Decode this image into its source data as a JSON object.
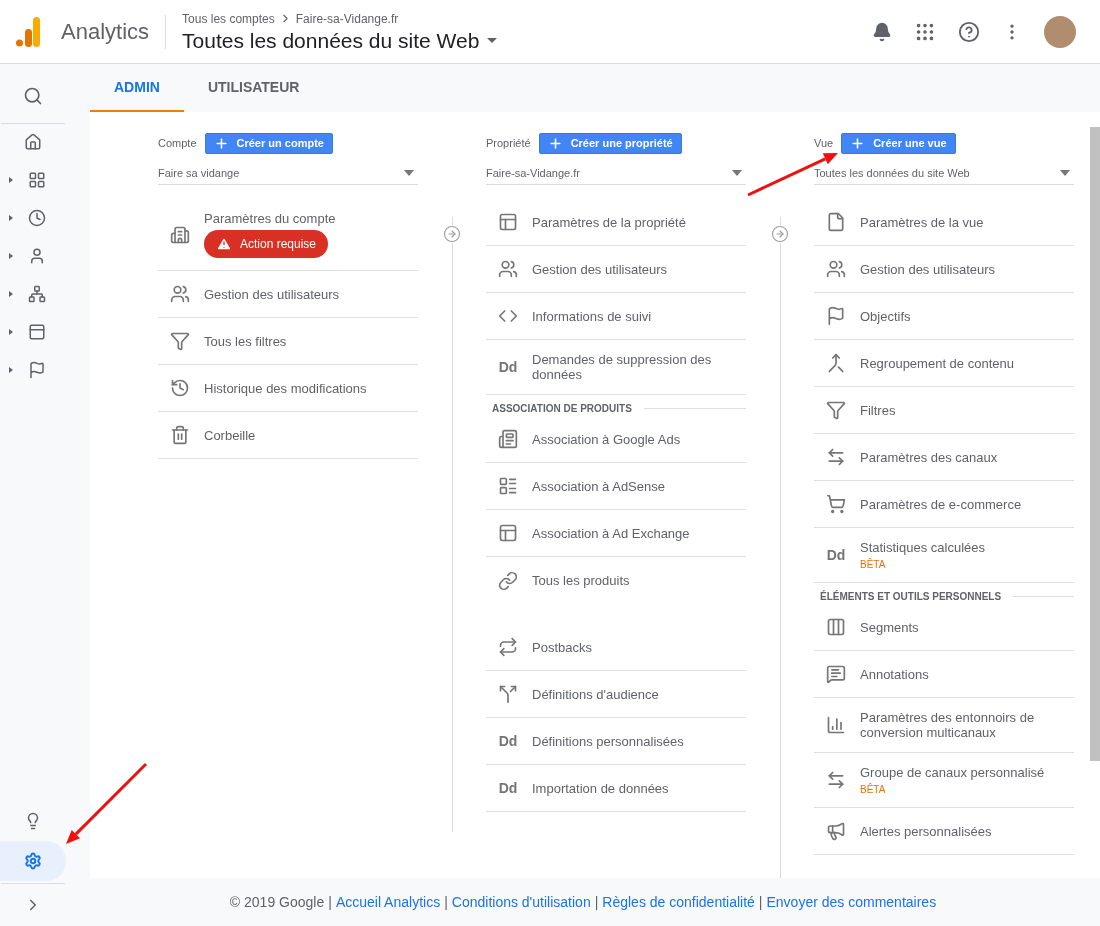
{
  "header": {
    "app_name": "Analytics",
    "breadcrumb": [
      "Tous les comptes",
      "Faire-sa-Vidange.fr"
    ],
    "view_title": "Toutes les données du site Web"
  },
  "sidebar": {
    "nav_items": [
      {
        "expanded": false
      },
      {
        "expanded": false
      },
      {
        "expanded": false
      },
      {
        "expanded": false
      },
      {
        "expanded": false
      },
      {
        "expanded": false
      }
    ],
    "bottom_items": [
      {
        "selected": false
      },
      {
        "selected": true
      }
    ]
  },
  "tabs": [
    {
      "label": "ADMIN",
      "selected": true
    },
    {
      "label": "UTILISATEUR",
      "selected": false
    }
  ],
  "columns": [
    {
      "label": "Compte",
      "create_button": "Créer un compte",
      "selector": "Faire sa vidange",
      "sections": [
        {
          "items": [
            {
              "label": "Paramètres du compte",
              "badge": "Action requise"
            },
            {
              "label": "Gestion des utilisateurs"
            },
            {
              "label": "Tous les filtres"
            },
            {
              "label": "Historique des modifications"
            },
            {
              "label": "Corbeille"
            }
          ]
        }
      ]
    },
    {
      "label": "Propriété",
      "create_button": "Créer une propriété",
      "selector": "Faire-sa-Vidange.fr",
      "sections": [
        {
          "items": [
            {
              "label": "Paramètres de la propriété"
            },
            {
              "label": "Gestion des utilisateurs"
            },
            {
              "label": "Informations de suivi"
            },
            {
              "label": "Demandes de suppression des données",
              "glyph": "Dd"
            }
          ]
        },
        {
          "heading": "ASSOCIATION DE PRODUITS",
          "items": [
            {
              "label": "Association à Google Ads"
            },
            {
              "label": "Association à AdSense"
            },
            {
              "label": "Association à Ad Exchange"
            },
            {
              "label": "Tous les produits"
            }
          ]
        },
        {
          "items": [
            {
              "label": "Postbacks"
            },
            {
              "label": "Définitions d'audience"
            },
            {
              "label": "Définitions personnalisées",
              "glyph": "Dd"
            },
            {
              "label": "Importation de données",
              "glyph": "Dd"
            }
          ]
        }
      ]
    },
    {
      "label": "Vue",
      "create_button": "Créer une vue",
      "selector": "Toutes les données du site Web",
      "sections": [
        {
          "items": [
            {
              "label": "Paramètres de la vue"
            },
            {
              "label": "Gestion des utilisateurs"
            },
            {
              "label": "Objectifs"
            },
            {
              "label": "Regroupement de contenu"
            },
            {
              "label": "Filtres"
            },
            {
              "label": "Paramètres des canaux"
            },
            {
              "label": "Paramètres de e-commerce"
            },
            {
              "label": "Statistiques calculées",
              "glyph": "Dd",
              "tag": "BÊTA"
            }
          ]
        },
        {
          "heading": "ÉLÉMENTS ET OUTILS PERSONNELS",
          "items": [
            {
              "label": "Segments"
            },
            {
              "label": "Annotations"
            },
            {
              "label": "Paramètres des entonnoirs de conversion multicanaux"
            },
            {
              "label": "Groupe de canaux personnalisé",
              "tag": "BÊTA"
            },
            {
              "label": "Alertes personnalisées"
            }
          ]
        }
      ]
    }
  ],
  "footer": {
    "parts": [
      {
        "kind": "text",
        "text": "© 2019 Google"
      },
      {
        "kind": "separator",
        "text": "|"
      },
      {
        "kind": "link",
        "text": "Accueil Analytics"
      },
      {
        "kind": "separator",
        "text": "|"
      },
      {
        "kind": "link",
        "text": "Conditions d'utilisation"
      },
      {
        "kind": "separator",
        "text": "|"
      },
      {
        "kind": "link",
        "text": "Règles de confidentialité"
      },
      {
        "kind": "separator",
        "text": "|"
      },
      {
        "kind": "link",
        "text": "Envoyer des commentaires"
      }
    ]
  }
}
